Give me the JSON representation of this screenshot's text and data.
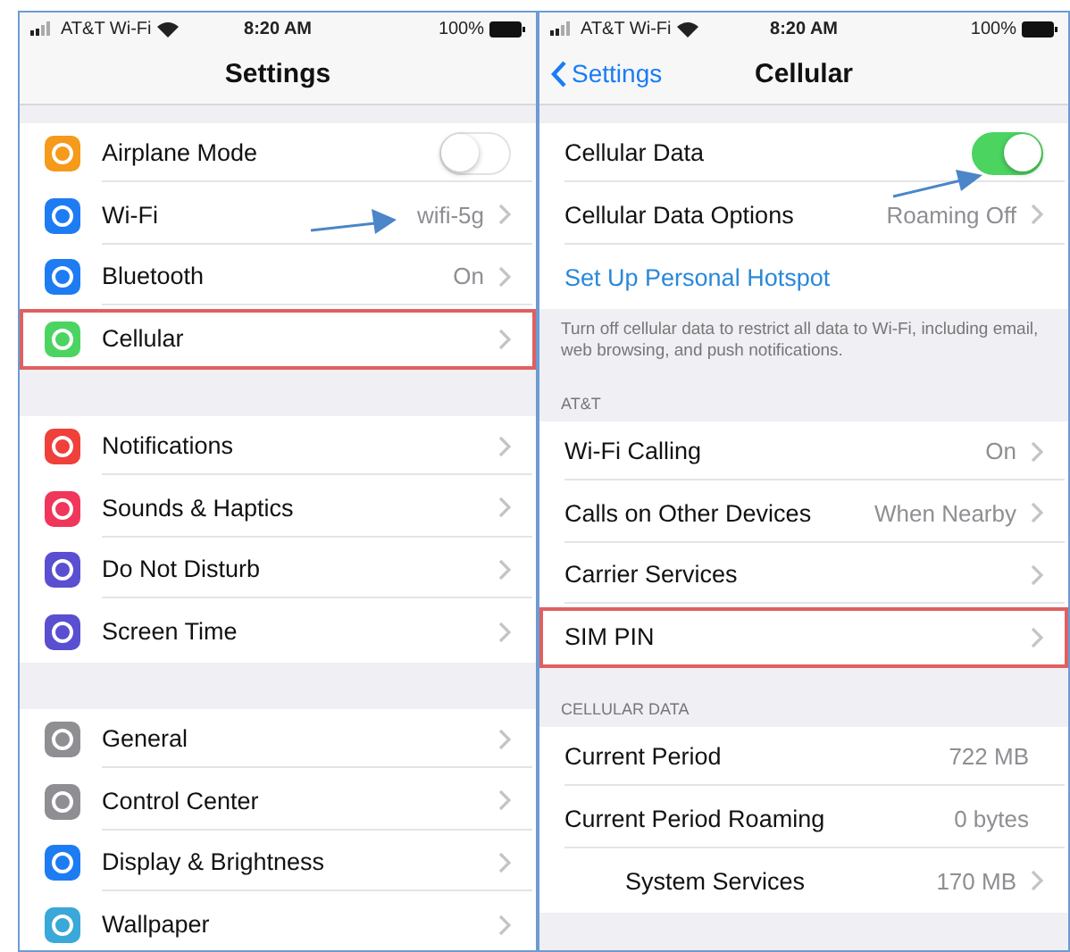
{
  "left_screen": {
    "status_bar": {
      "carrier": "AT&T Wi-Fi",
      "time": "8:20 AM",
      "battery": "100%"
    },
    "title": "Settings",
    "sections": [
      {
        "rows": [
          {
            "label": "Airplane Mode",
            "kind": "toggle",
            "on": false,
            "color": "#f59a1b",
            "highlighted": false
          },
          {
            "label": "Wi-Fi",
            "value": "wifi-5g",
            "kind": "chevron",
            "color": "#1e7cf2",
            "highlighted": false
          },
          {
            "label": "Bluetooth",
            "value": "On",
            "kind": "chevron",
            "color": "#1e7cf2",
            "highlighted": false
          },
          {
            "label": "Cellular",
            "kind": "chevron",
            "color": "#4cd461",
            "highlighted": true
          }
        ]
      },
      {
        "rows": [
          {
            "label": "Notifications",
            "kind": "chevron",
            "color": "#f0403a",
            "highlighted": false
          },
          {
            "label": "Sounds & Haptics",
            "kind": "chevron",
            "color": "#f0365a",
            "highlighted": false
          },
          {
            "label": "Do Not Disturb",
            "kind": "chevron",
            "color": "#5a4fd0",
            "highlighted": false
          },
          {
            "label": "Screen Time",
            "kind": "chevron",
            "color": "#5a4fd0",
            "highlighted": false
          }
        ]
      },
      {
        "rows": [
          {
            "label": "General",
            "kind": "chevron",
            "color": "#8e8e93",
            "highlighted": false
          },
          {
            "label": "Control Center",
            "kind": "chevron",
            "color": "#8e8e93",
            "highlighted": false
          },
          {
            "label": "Display & Brightness",
            "kind": "chevron",
            "color": "#1e7cf2",
            "highlighted": false
          },
          {
            "label": "Wallpaper",
            "kind": "chevron",
            "color": "#3aa8d8",
            "highlighted": false
          }
        ]
      }
    ]
  },
  "right_screen": {
    "status_bar": {
      "carrier": "AT&T Wi-Fi",
      "time": "8:20 AM",
      "battery": "100%"
    },
    "back": "Settings",
    "title": "Cellular",
    "sections": [
      {
        "rows": [
          {
            "label": "Cellular Data",
            "kind": "toggle",
            "on": true,
            "indented": false,
            "highlighted": false
          },
          {
            "label": "Cellular Data Options",
            "value": "Roaming Off",
            "kind": "chevron",
            "indented": false,
            "highlighted": false
          },
          {
            "label": "Set Up Personal Hotspot",
            "kind": "link",
            "indented": false,
            "highlighted": false
          }
        ],
        "footer": "Turn off cellular data to restrict all data to Wi-Fi, including email, web browsing, and push notifications."
      },
      {
        "header": "AT&T",
        "rows": [
          {
            "label": "Wi-Fi Calling",
            "value": "On",
            "kind": "chevron",
            "indented": false,
            "highlighted": false
          },
          {
            "label": "Calls on Other Devices",
            "value": "When Nearby",
            "kind": "chevron",
            "indented": false,
            "highlighted": false
          },
          {
            "label": "Carrier Services",
            "kind": "chevron",
            "indented": false,
            "highlighted": false
          },
          {
            "label": "SIM PIN",
            "kind": "chevron",
            "indented": false,
            "highlighted": true
          }
        ]
      },
      {
        "header": "CELLULAR DATA",
        "rows": [
          {
            "label": "Current Period",
            "value": "722 MB",
            "kind": "value",
            "indented": false,
            "highlighted": false
          },
          {
            "label": "Current Period Roaming",
            "value": "0 bytes",
            "kind": "value",
            "indented": false,
            "highlighted": false
          },
          {
            "label": "System Services",
            "value": "170 MB",
            "kind": "chevron",
            "indented": true,
            "highlighted": false
          }
        ]
      }
    ]
  }
}
